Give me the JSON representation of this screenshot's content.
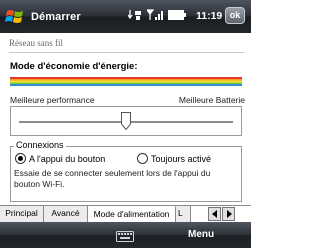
{
  "titlebar": {
    "title": "Démarrer",
    "clock": "11:19",
    "ok_label": "ok",
    "icons": [
      "windows-start-icon",
      "connectivity-icon",
      "signal-icon",
      "battery-icon"
    ]
  },
  "page": {
    "heading": "Réseau sans fil"
  },
  "power": {
    "label": "Mode d'économie d'énergie:",
    "left_caption": "Meilleure performance",
    "right_caption": "Meilleure Batterie",
    "slider_level_fraction": 0.5
  },
  "connections": {
    "legend": "Connexions",
    "options": [
      {
        "label": "A l'appui du bouton",
        "selected": true
      },
      {
        "label": "Toujours activé",
        "selected": false
      }
    ],
    "hint": "Essaie de se connecter seulement lors de l'appui du bouton Wi-Fi."
  },
  "tabs": [
    {
      "label": "Principal",
      "active": false
    },
    {
      "label": "Avancé",
      "active": false
    },
    {
      "label": "Mode d'alimentation",
      "active": true
    },
    {
      "label": "L",
      "active": false
    }
  ],
  "softkeys": {
    "right_label": "Menu",
    "center_icon": "keyboard-icon"
  },
  "colors": {
    "bar_top": "#2b2f36",
    "energy_gradient": [
      "#e33a2a",
      "#f29a24",
      "#f4e02e",
      "#7ccb3e",
      "#2f8fd8"
    ]
  }
}
